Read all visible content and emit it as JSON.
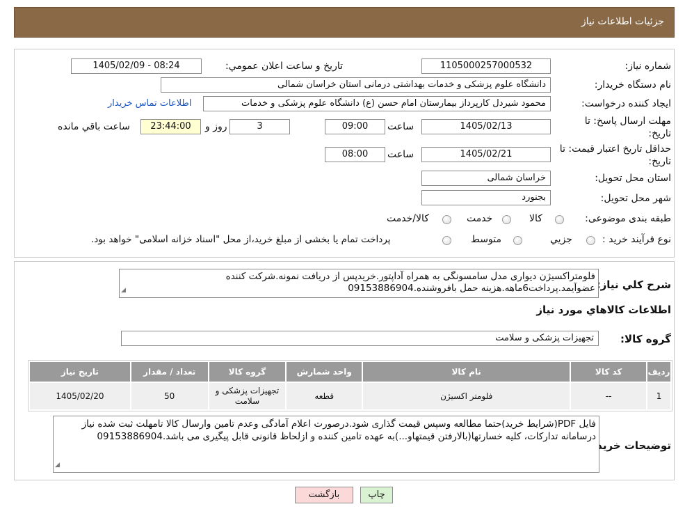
{
  "header": {
    "title": "جزئیات اطلاعات نیاز"
  },
  "fields": {
    "need_number_label": "شماره نیاز:",
    "need_number": "1105000257000532",
    "announce_label": "تاریخ و ساعت اعلان عمومي:",
    "announce_value": "1405/02/09 - 08:24",
    "buyer_org_label": "نام دستگاه خريدار:",
    "buyer_org": "دانشگاه علوم پزشکی و خدمات بهداشتی درمانی استان خراسان شمالی",
    "requester_label": "ايجاد کننده درخواست:",
    "requester": "محمود شیردل کارپرداز بیمارستان امام حسن (ع) دانشگاه علوم پزشکی و خدمات",
    "contact_link": "اطلاعات تماس خريدار",
    "deadline_label": "مهلت ارسال پاسخ: تا تاريخ:",
    "deadline_date": "1405/02/13",
    "time_label": "ساعت",
    "deadline_time": "09:00",
    "days_value": "3",
    "days_label": "روز و",
    "remaining_time": "23:44:00",
    "remaining_label": "ساعت باقي مانده",
    "validity_label": "حداقل تاريخ اعتبار قيمت: تا تاريخ:",
    "validity_date": "1405/02/21",
    "validity_time_label": "ساعت",
    "validity_time": "08:00",
    "province_label": "استان محل تحويل:",
    "province": "خراسان شمالی",
    "city_label": "شهر محل تحويل:",
    "city": "بجنورد",
    "category_label": "طبقه بندی موضوعی:",
    "category_options": [
      "کالا",
      "خدمت",
      "کالا/خدمت"
    ],
    "process_label": "نوع فرآيند خريد :",
    "process_options": [
      "جزيي",
      "متوسط"
    ],
    "process_note": "پرداخت تمام يا بخشی از مبلغ خريد،از محل \"اسناد خزانه اسلامی\" خواهد بود."
  },
  "description": {
    "label": "شرح کلي نياز:",
    "text": "فلومتراکسیژن دیواری مدل سامسونگی به همراه آداپتور.خریدپس از دریافت نمونه.شرکت کننده عضوآیمد.پرداخت6ماهه.هزینه حمل بافروشنده.09153886904"
  },
  "goods": {
    "section_title": "اطلاعات کالاهاي مورد نياز",
    "group_label": "گروه کالا:",
    "group_value": "تجهيزات پزشکی و سلامت",
    "columns": [
      "رديف",
      "کد کالا",
      "نام کالا",
      "واحد شمارش",
      "گروه کالا",
      "تعداد / مقدار",
      "تاريخ نياز"
    ],
    "rows": [
      [
        "1",
        "--",
        "فلومتر اکسیژن",
        "قطعه",
        "تجهیزات پزشکی و سلامت",
        "50",
        "1405/02/20"
      ]
    ]
  },
  "buyer_notes": {
    "label": "توضيحات خريدار:",
    "text": "فایل PDF(شرایط خرید)حتما مطالعه وسپس قیمت گذاری شود.درصورت اعلام آمادگی وعدم تامین وارسال کالا تامهلت ثبت شده نیاز درسامانه تدارکات، کلیه خسارتها(بالارفتن قیمتهاو...)به عهده تامین کننده و ازلحاظ قانونی قابل پیگیری می باشد.09153886904"
  },
  "buttons": {
    "print": "چاپ",
    "back": "بازگشت"
  }
}
